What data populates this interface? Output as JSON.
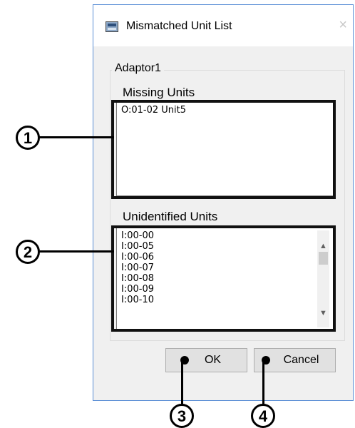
{
  "window": {
    "title": "Mismatched Unit List",
    "close_glyph": "×",
    "icon": "app-window-icon"
  },
  "group": {
    "label": "Adaptor1"
  },
  "missing_units": {
    "label": "Missing Units",
    "items": [
      "O:01-02 Unit5"
    ]
  },
  "unidentified_units": {
    "label": "Unidentified Units",
    "items": [
      "I:00-00",
      "I:00-05",
      "I:00-06",
      "I:00-07",
      "I:00-08",
      "I:00-09",
      "I:00-10"
    ]
  },
  "buttons": {
    "ok_label": "OK",
    "cancel_label": "Cancel"
  },
  "callouts": {
    "c1": "1",
    "c2": "2",
    "c3": "3",
    "c4": "4"
  },
  "colors": {
    "dialog_bg": "#f0f0f0",
    "window_border": "#5b8fd6",
    "highlight": "#111111"
  }
}
